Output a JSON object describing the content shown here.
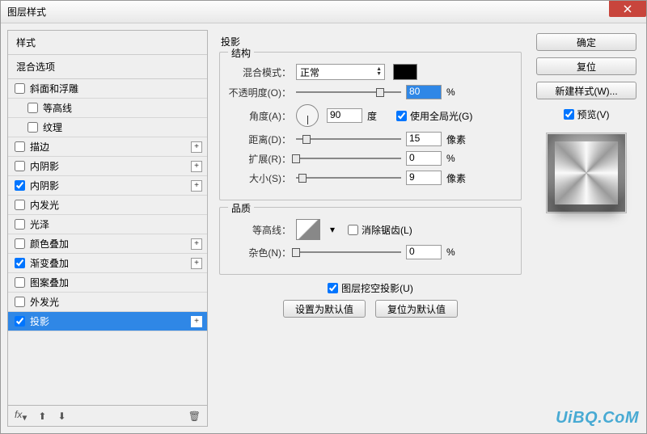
{
  "window": {
    "title": "图层样式"
  },
  "left": {
    "styles_header": "样式",
    "blend_header": "混合选项",
    "items": [
      {
        "label": "斜面和浮雕",
        "checked": false,
        "plus": false,
        "indent": false
      },
      {
        "label": "等高线",
        "checked": false,
        "plus": false,
        "indent": true
      },
      {
        "label": "纹理",
        "checked": false,
        "plus": false,
        "indent": true
      },
      {
        "label": "描边",
        "checked": false,
        "plus": true,
        "indent": false
      },
      {
        "label": "内阴影",
        "checked": false,
        "plus": true,
        "indent": false
      },
      {
        "label": "内阴影",
        "checked": true,
        "plus": true,
        "indent": false
      },
      {
        "label": "内发光",
        "checked": false,
        "plus": false,
        "indent": false
      },
      {
        "label": "光泽",
        "checked": false,
        "plus": false,
        "indent": false
      },
      {
        "label": "颜色叠加",
        "checked": false,
        "plus": true,
        "indent": false
      },
      {
        "label": "渐变叠加",
        "checked": true,
        "plus": true,
        "indent": false
      },
      {
        "label": "图案叠加",
        "checked": false,
        "plus": false,
        "indent": false
      },
      {
        "label": "外发光",
        "checked": false,
        "plus": false,
        "indent": false
      },
      {
        "label": "投影",
        "checked": true,
        "plus": true,
        "indent": false,
        "selected": true
      }
    ],
    "footer_fx": "fx"
  },
  "center": {
    "title": "投影",
    "structure": {
      "legend": "结构",
      "blend_mode_label": "混合模式：",
      "blend_mode_value": "正常",
      "opacity_label": "不透明度(O)：",
      "opacity_value": "80",
      "opacity_unit": "%",
      "angle_label": "角度(A)：",
      "angle_value": "90",
      "angle_unit": "度",
      "global_light_label": "使用全局光(G)",
      "global_light_checked": true,
      "distance_label": "距离(D)：",
      "distance_value": "15",
      "distance_unit": "像素",
      "spread_label": "扩展(R)：",
      "spread_value": "0",
      "spread_unit": "%",
      "size_label": "大小(S)：",
      "size_value": "9",
      "size_unit": "像素"
    },
    "quality": {
      "legend": "品质",
      "contour_label": "等高线：",
      "antialias_label": "消除锯齿(L)",
      "antialias_checked": false,
      "noise_label": "杂色(N)：",
      "noise_value": "0",
      "noise_unit": "%"
    },
    "knockout_label": "图层挖空投影(U)",
    "knockout_checked": true,
    "btn_default": "设置为默认值",
    "btn_reset": "复位为默认值"
  },
  "right": {
    "ok": "确定",
    "cancel": "复位",
    "new_style": "新建样式(W)...",
    "preview_label": "预览(V)",
    "preview_checked": true
  },
  "watermark": "UiBQ.CoM"
}
